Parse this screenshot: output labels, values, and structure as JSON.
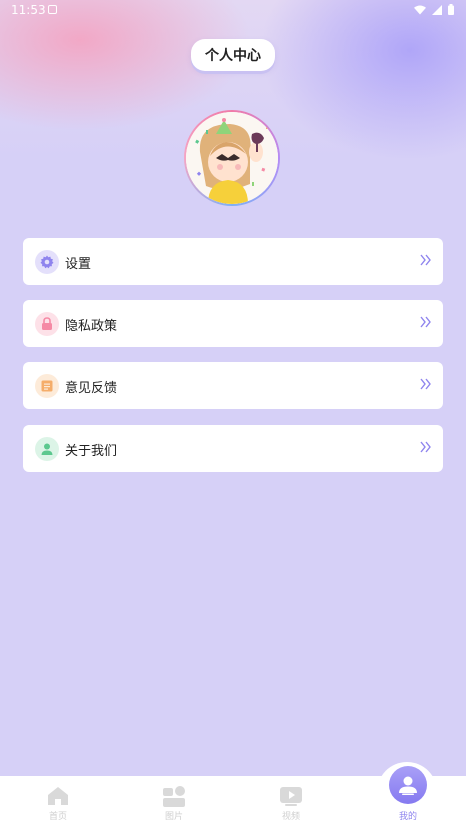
{
  "status_bar": {
    "time": "11:53"
  },
  "header": {
    "title": "个人中心"
  },
  "menu": [
    {
      "label": "设置",
      "icon": "gear-icon",
      "color": "#8f84ee",
      "bg": "#e4e0fb"
    },
    {
      "label": "隐私政策",
      "icon": "lock-icon",
      "color": "#f58aa5",
      "bg": "#fde1e8"
    },
    {
      "label": "意见反馈",
      "icon": "feedback-icon",
      "color": "#f5ad6a",
      "bg": "#fdebd9"
    },
    {
      "label": "关于我们",
      "icon": "person-icon",
      "color": "#5cc88f",
      "bg": "#dcf4e7"
    }
  ],
  "tabs": [
    {
      "label": "首页",
      "icon": "home-icon"
    },
    {
      "label": "图片",
      "icon": "image-icon"
    },
    {
      "label": "视频",
      "icon": "video-icon"
    },
    {
      "label": "我的",
      "icon": "profile-icon",
      "active": true
    }
  ],
  "colors": {
    "accent": "#8f84ee",
    "background": "#d6d0f7"
  }
}
